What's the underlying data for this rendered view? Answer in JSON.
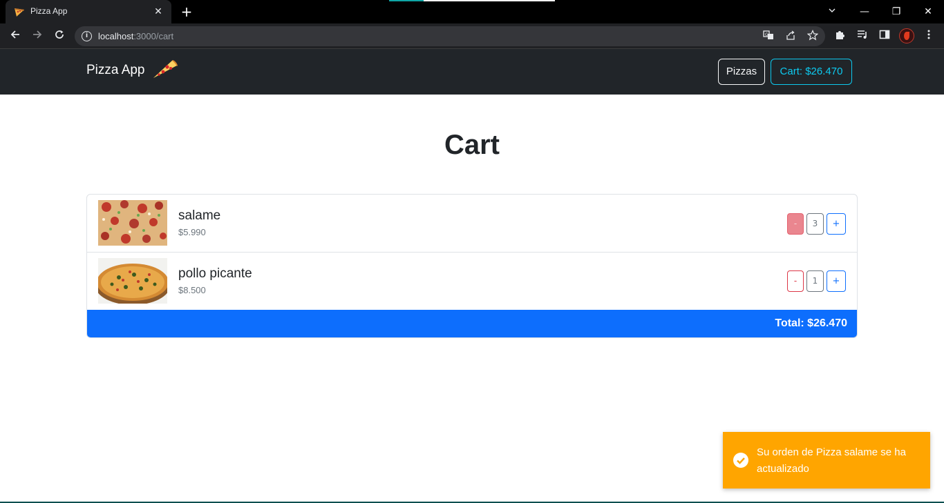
{
  "browser": {
    "tab_title": "Pizza App",
    "tab_close": "✕",
    "new_tab": "+",
    "url_host": "localhost",
    "url_path": ":3000/cart",
    "window_controls": {
      "minimize": "—",
      "restore": "❐",
      "close": "✕"
    }
  },
  "navbar": {
    "brand": "Pizza App",
    "pizzas_label": "Pizzas",
    "cart_label": "Cart: $26.470"
  },
  "page": {
    "title": "Cart"
  },
  "cart": {
    "items": [
      {
        "name": "salame",
        "price": "$5.990",
        "minus": "-",
        "quantity": "3",
        "plus": "+",
        "minus_disabled": true
      },
      {
        "name": "pollo picante",
        "price": "$8.500",
        "minus": "-",
        "quantity": "1",
        "plus": "+",
        "minus_disabled": false
      }
    ],
    "total": "Total: $26.470"
  },
  "toast": {
    "message": "Su orden de Pizza salame se ha actualizado",
    "color": "#ffa500"
  },
  "colors": {
    "navbar_bg": "#212529",
    "primary": "#0d6efd",
    "danger": "#dc3545",
    "info": "#0dcaf0"
  }
}
